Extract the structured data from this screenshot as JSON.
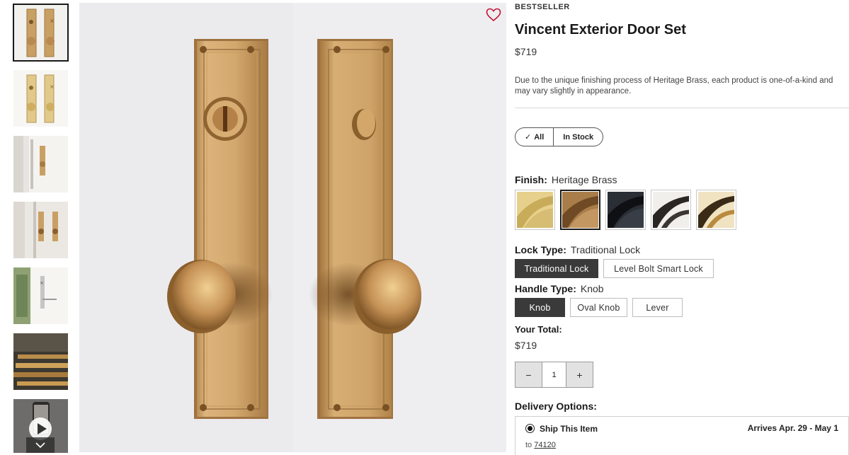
{
  "product": {
    "eyebrow": "BESTSELLER",
    "title": "Vincent Exterior Door Set",
    "price": "$719",
    "description": "Due to the unique finishing process of Heritage Brass, each product is one-of-a-kind and may vary slightly in appearance."
  },
  "filters": {
    "all_label": "All",
    "in_stock_label": "In Stock",
    "selected": "All"
  },
  "finish": {
    "label": "Finish:",
    "value": "Heritage Brass",
    "swatches": [
      {
        "name": "Satin Brass",
        "color": "#d9c07a",
        "selected": false
      },
      {
        "name": "Heritage Brass",
        "color": "#9c7444",
        "selected": true
      },
      {
        "name": "Matte Black",
        "color": "#1c1f24",
        "selected": false
      },
      {
        "name": "Polished Nickel",
        "color": "#e8e6e2",
        "selected": false
      },
      {
        "name": "Polished Brass",
        "color": "#e8d6a7",
        "selected": false
      }
    ]
  },
  "lock_type": {
    "label": "Lock Type:",
    "value": "Traditional Lock",
    "options": [
      "Traditional Lock",
      "Level Bolt Smart Lock"
    ],
    "selected_index": 0
  },
  "handle_type": {
    "label": "Handle Type:",
    "value": "Knob",
    "options": [
      "Knob",
      "Oval Knob",
      "Lever"
    ],
    "selected_index": 0
  },
  "total": {
    "label": "Your Total:",
    "value": "$719"
  },
  "quantity": {
    "minus": "−",
    "value": "1",
    "plus": "+"
  },
  "delivery": {
    "label": "Delivery Options:",
    "ship_label": "Ship This Item",
    "arrives": "Arrives Apr. 29 - May 1",
    "to_prefix": "to",
    "zip": "74120"
  },
  "icons": {
    "favorite": "heart-icon",
    "play": "play-icon",
    "scroll_down": "chevron-down-icon"
  },
  "colors": {
    "brass": "#c89a5c",
    "accent_heart": "#c8102e",
    "selected_button": "#3a3a3a"
  }
}
